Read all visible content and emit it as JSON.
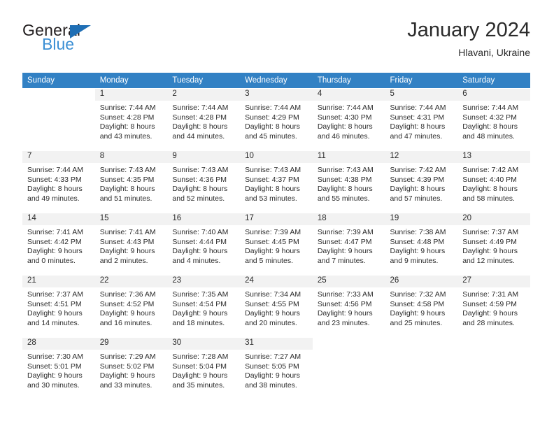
{
  "logo": {
    "word_top": "General",
    "word_bottom": "Blue",
    "triangle_color": "#1f6fb5",
    "blue_color": "#3b8fd4"
  },
  "header": {
    "title": "January 2024",
    "subtitle": "Hlavani, Ukraine"
  },
  "theme": {
    "header_bg": "#3281c4",
    "header_text": "#ffffff",
    "daynum_bg": "#f2f2f2",
    "text": "#2b2b2b"
  },
  "calendar": {
    "weekday_headers": [
      "Sunday",
      "Monday",
      "Tuesday",
      "Wednesday",
      "Thursday",
      "Friday",
      "Saturday"
    ],
    "weeks": [
      [
        {
          "day": "",
          "lines": []
        },
        {
          "day": "1",
          "lines": [
            "Sunrise: 7:44 AM",
            "Sunset: 4:28 PM",
            "Daylight: 8 hours",
            "and 43 minutes."
          ]
        },
        {
          "day": "2",
          "lines": [
            "Sunrise: 7:44 AM",
            "Sunset: 4:28 PM",
            "Daylight: 8 hours",
            "and 44 minutes."
          ]
        },
        {
          "day": "3",
          "lines": [
            "Sunrise: 7:44 AM",
            "Sunset: 4:29 PM",
            "Daylight: 8 hours",
            "and 45 minutes."
          ]
        },
        {
          "day": "4",
          "lines": [
            "Sunrise: 7:44 AM",
            "Sunset: 4:30 PM",
            "Daylight: 8 hours",
            "and 46 minutes."
          ]
        },
        {
          "day": "5",
          "lines": [
            "Sunrise: 7:44 AM",
            "Sunset: 4:31 PM",
            "Daylight: 8 hours",
            "and 47 minutes."
          ]
        },
        {
          "day": "6",
          "lines": [
            "Sunrise: 7:44 AM",
            "Sunset: 4:32 PM",
            "Daylight: 8 hours",
            "and 48 minutes."
          ]
        }
      ],
      [
        {
          "day": "7",
          "lines": [
            "Sunrise: 7:44 AM",
            "Sunset: 4:33 PM",
            "Daylight: 8 hours",
            "and 49 minutes."
          ]
        },
        {
          "day": "8",
          "lines": [
            "Sunrise: 7:43 AM",
            "Sunset: 4:35 PM",
            "Daylight: 8 hours",
            "and 51 minutes."
          ]
        },
        {
          "day": "9",
          "lines": [
            "Sunrise: 7:43 AM",
            "Sunset: 4:36 PM",
            "Daylight: 8 hours",
            "and 52 minutes."
          ]
        },
        {
          "day": "10",
          "lines": [
            "Sunrise: 7:43 AM",
            "Sunset: 4:37 PM",
            "Daylight: 8 hours",
            "and 53 minutes."
          ]
        },
        {
          "day": "11",
          "lines": [
            "Sunrise: 7:43 AM",
            "Sunset: 4:38 PM",
            "Daylight: 8 hours",
            "and 55 minutes."
          ]
        },
        {
          "day": "12",
          "lines": [
            "Sunrise: 7:42 AM",
            "Sunset: 4:39 PM",
            "Daylight: 8 hours",
            "and 57 minutes."
          ]
        },
        {
          "day": "13",
          "lines": [
            "Sunrise: 7:42 AM",
            "Sunset: 4:40 PM",
            "Daylight: 8 hours",
            "and 58 minutes."
          ]
        }
      ],
      [
        {
          "day": "14",
          "lines": [
            "Sunrise: 7:41 AM",
            "Sunset: 4:42 PM",
            "Daylight: 9 hours",
            "and 0 minutes."
          ]
        },
        {
          "day": "15",
          "lines": [
            "Sunrise: 7:41 AM",
            "Sunset: 4:43 PM",
            "Daylight: 9 hours",
            "and 2 minutes."
          ]
        },
        {
          "day": "16",
          "lines": [
            "Sunrise: 7:40 AM",
            "Sunset: 4:44 PM",
            "Daylight: 9 hours",
            "and 4 minutes."
          ]
        },
        {
          "day": "17",
          "lines": [
            "Sunrise: 7:39 AM",
            "Sunset: 4:45 PM",
            "Daylight: 9 hours",
            "and 5 minutes."
          ]
        },
        {
          "day": "18",
          "lines": [
            "Sunrise: 7:39 AM",
            "Sunset: 4:47 PM",
            "Daylight: 9 hours",
            "and 7 minutes."
          ]
        },
        {
          "day": "19",
          "lines": [
            "Sunrise: 7:38 AM",
            "Sunset: 4:48 PM",
            "Daylight: 9 hours",
            "and 9 minutes."
          ]
        },
        {
          "day": "20",
          "lines": [
            "Sunrise: 7:37 AM",
            "Sunset: 4:49 PM",
            "Daylight: 9 hours",
            "and 12 minutes."
          ]
        }
      ],
      [
        {
          "day": "21",
          "lines": [
            "Sunrise: 7:37 AM",
            "Sunset: 4:51 PM",
            "Daylight: 9 hours",
            "and 14 minutes."
          ]
        },
        {
          "day": "22",
          "lines": [
            "Sunrise: 7:36 AM",
            "Sunset: 4:52 PM",
            "Daylight: 9 hours",
            "and 16 minutes."
          ]
        },
        {
          "day": "23",
          "lines": [
            "Sunrise: 7:35 AM",
            "Sunset: 4:54 PM",
            "Daylight: 9 hours",
            "and 18 minutes."
          ]
        },
        {
          "day": "24",
          "lines": [
            "Sunrise: 7:34 AM",
            "Sunset: 4:55 PM",
            "Daylight: 9 hours",
            "and 20 minutes."
          ]
        },
        {
          "day": "25",
          "lines": [
            "Sunrise: 7:33 AM",
            "Sunset: 4:56 PM",
            "Daylight: 9 hours",
            "and 23 minutes."
          ]
        },
        {
          "day": "26",
          "lines": [
            "Sunrise: 7:32 AM",
            "Sunset: 4:58 PM",
            "Daylight: 9 hours",
            "and 25 minutes."
          ]
        },
        {
          "day": "27",
          "lines": [
            "Sunrise: 7:31 AM",
            "Sunset: 4:59 PM",
            "Daylight: 9 hours",
            "and 28 minutes."
          ]
        }
      ],
      [
        {
          "day": "28",
          "lines": [
            "Sunrise: 7:30 AM",
            "Sunset: 5:01 PM",
            "Daylight: 9 hours",
            "and 30 minutes."
          ]
        },
        {
          "day": "29",
          "lines": [
            "Sunrise: 7:29 AM",
            "Sunset: 5:02 PM",
            "Daylight: 9 hours",
            "and 33 minutes."
          ]
        },
        {
          "day": "30",
          "lines": [
            "Sunrise: 7:28 AM",
            "Sunset: 5:04 PM",
            "Daylight: 9 hours",
            "and 35 minutes."
          ]
        },
        {
          "day": "31",
          "lines": [
            "Sunrise: 7:27 AM",
            "Sunset: 5:05 PM",
            "Daylight: 9 hours",
            "and 38 minutes."
          ]
        },
        {
          "day": "",
          "lines": []
        },
        {
          "day": "",
          "lines": []
        },
        {
          "day": "",
          "lines": []
        }
      ]
    ]
  }
}
